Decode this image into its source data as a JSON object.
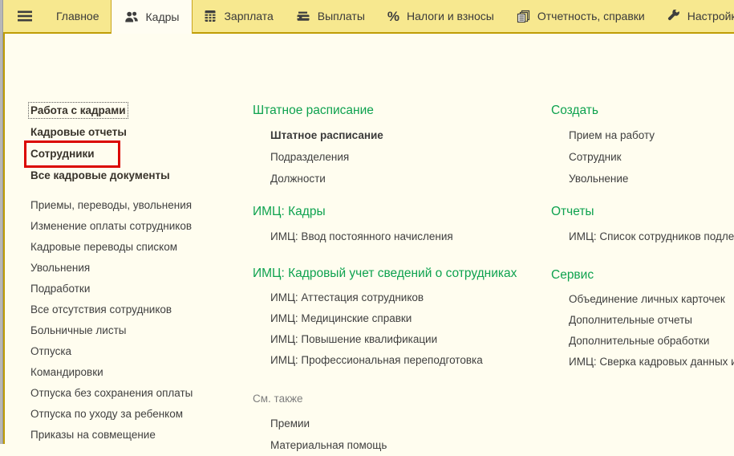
{
  "tabbar": {
    "tabs": [
      {
        "label": "Главное"
      },
      {
        "label": "Кадры",
        "active": true
      },
      {
        "label": "Зарплата"
      },
      {
        "label": "Выплаты"
      },
      {
        "label": "Налоги и взносы",
        "glyph": "%"
      },
      {
        "label": "Отчетность, справки"
      },
      {
        "label": "Настройка"
      }
    ]
  },
  "left_panel": {
    "primary_links": [
      "Работа с кадрами",
      "Кадровые отчеты",
      "Сотрудники",
      "Все кадровые документы"
    ],
    "focused_link": "Работа с кадрами",
    "highlighted_link": "Сотрудники",
    "links": [
      "Приемы, переводы, увольнения",
      "Изменение оплаты сотрудников",
      "Кадровые переводы списком",
      "Увольнения",
      "Подработки",
      "Все отсутствия сотрудников",
      "Больничные листы",
      "Отпуска",
      "Командировки",
      "Отпуска без сохранения оплаты",
      "Отпуска по уходу за ребенком",
      "Приказы на совмещение"
    ]
  },
  "middle_panel": {
    "sections": [
      {
        "title": "Штатное расписание",
        "items": [
          "Штатное расписание",
          "Подразделения",
          "Должности"
        ]
      },
      {
        "title": "ИМЦ: Кадры",
        "items": [
          "ИМЦ: Ввод постоянного начисления"
        ]
      },
      {
        "title": "ИМЦ: Кадровый учет сведений о сотрудниках",
        "items": [
          "ИМЦ: Аттестация сотрудников",
          "ИМЦ: Медицинские справки",
          "ИМЦ: Повышение квалификации",
          "ИМЦ: Профессиональная переподготовка"
        ]
      },
      {
        "title": "См. также",
        "items": [
          "Премии",
          "Материальная помощь"
        ]
      }
    ]
  },
  "right_panel": {
    "sections": [
      {
        "title": "Создать",
        "items": [
          "Прием на работу",
          "Сотрудник",
          "Увольнение"
        ]
      },
      {
        "title": "Отчеты",
        "items": [
          "ИМЦ: Список сотрудников подлеж"
        ]
      },
      {
        "title": "Сервис",
        "items": [
          "Объединение личных карточек",
          "Дополнительные отчеты",
          "Дополнительные обработки",
          "ИМЦ: Сверка кадровых данных и С"
        ]
      }
    ]
  },
  "colors": {
    "tab_bar_bg": "#f7e88f",
    "gold_border": "#bf9d06",
    "content_bg": "#fffdef",
    "section_green": "#0ea24f",
    "annotation_red": "#db0400"
  }
}
